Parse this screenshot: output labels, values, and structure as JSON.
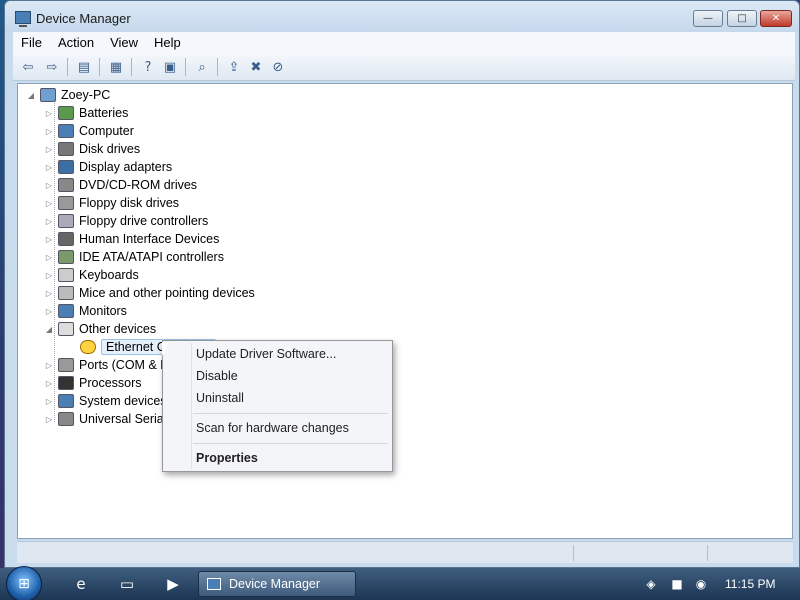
{
  "window": {
    "title": "Device Manager",
    "buttons": {
      "minimize": "—",
      "maximize": "□",
      "close": "✕"
    }
  },
  "menubar": {
    "items": [
      "File",
      "Action",
      "View",
      "Help"
    ]
  },
  "toolbar": {
    "icons": [
      "back-icon",
      "forward-icon",
      "show-hide-console-tree-icon",
      "properties-icon",
      "help-icon",
      "action-pane-icon",
      "scan-hardware-icon",
      "update-driver-icon",
      "uninstall-icon",
      "disable-icon"
    ]
  },
  "tree": {
    "root": "Zoey-PC",
    "items": [
      {
        "label": "Batteries",
        "icon": "battery-icon",
        "expander": "▷"
      },
      {
        "label": "Computer",
        "icon": "computer-icon",
        "expander": "▷"
      },
      {
        "label": "Disk drives",
        "icon": "disk-drive-icon",
        "expander": "▷"
      },
      {
        "label": "Display adapters",
        "icon": "display-adapter-icon",
        "expander": "▷"
      },
      {
        "label": "DVD/CD-ROM drives",
        "icon": "dvd-drive-icon",
        "expander": "▷"
      },
      {
        "label": "Floppy disk drives",
        "icon": "floppy-disk-icon",
        "expander": "▷"
      },
      {
        "label": "Floppy drive controllers",
        "icon": "floppy-controller-icon",
        "expander": "▷"
      },
      {
        "label": "Human Interface Devices",
        "icon": "hid-icon",
        "expander": "▷"
      },
      {
        "label": "IDE ATA/ATAPI controllers",
        "icon": "ide-controller-icon",
        "expander": "▷"
      },
      {
        "label": "Keyboards",
        "icon": "keyboard-icon",
        "expander": "▷"
      },
      {
        "label": "Mice and other pointing devices",
        "icon": "mouse-icon",
        "expander": "▷"
      },
      {
        "label": "Monitors",
        "icon": "monitor-icon",
        "expander": "▷"
      },
      {
        "label": "Other devices",
        "icon": "unknown-device-icon",
        "expander": "◢"
      },
      {
        "label": "Ethernet Controller",
        "icon": "warning-device-icon",
        "expander": ""
      },
      {
        "label": "Ports (COM & LPT)",
        "icon": "port-icon",
        "expander": "▷"
      },
      {
        "label": "Processors",
        "icon": "processor-icon",
        "expander": "▷"
      },
      {
        "label": "System devices",
        "icon": "system-device-icon",
        "expander": "▷"
      },
      {
        "label": "Universal Serial Bus controllers",
        "icon": "usb-icon",
        "expander": "▷"
      }
    ]
  },
  "context_menu": {
    "items": [
      {
        "label": "Update Driver Software...",
        "bold": false
      },
      {
        "label": "Disable",
        "bold": false
      },
      {
        "label": "Uninstall",
        "bold": false
      },
      {
        "label": "Scan for hardware changes",
        "bold": false
      },
      {
        "label": "Properties",
        "bold": true
      }
    ]
  },
  "taskbar": {
    "start": "⊞",
    "quick_launch": [
      "ie-icon",
      "explorer-icon",
      "media-player-icon"
    ],
    "active_task": "Device Manager",
    "tray_icons": [
      "network-icon",
      "flag-icon",
      "speaker-icon"
    ],
    "clock": "11:15 PM"
  }
}
